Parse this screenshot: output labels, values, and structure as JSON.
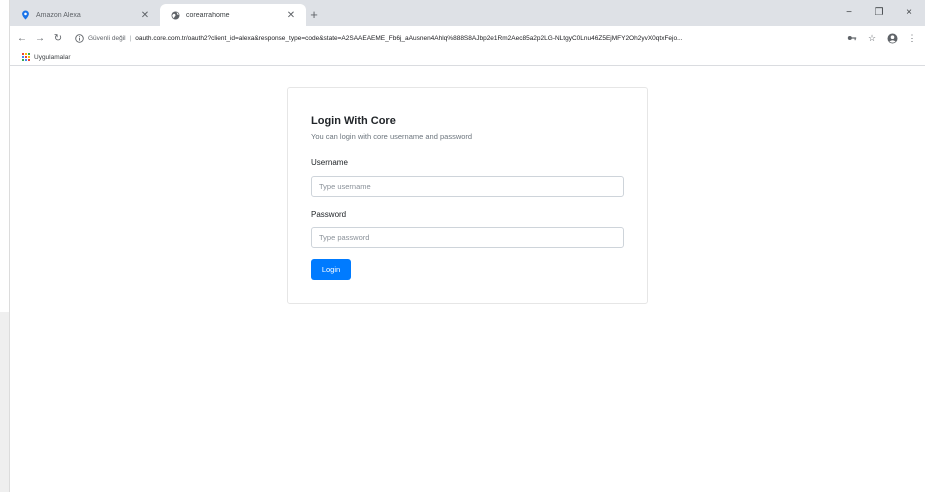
{
  "browser": {
    "tabs": [
      {
        "title": "Amazon Alexa",
        "icon": "location-pin-icon",
        "icon_color": "#1a73e8"
      },
      {
        "title": "corearrahome",
        "icon": "globe-icon"
      }
    ],
    "window_controls": {
      "minimize": "−",
      "maximize": "❐",
      "close": "×"
    },
    "address_bar": {
      "security_text": "Güvenli değil",
      "separator": "|",
      "url": "oauth.core.com.tr/oauth2?client_id=alexa&response_type=code&state=A2SAAEAEME_Fb6j_aAusnen4Ahlq%888S8AJbp2e1Rm2Aec85a2p2LG-NLtgyC0Lnu46Z5EjMFY2Oh2yvX0qtxFejo..."
    },
    "bookmarks": [
      {
        "label": "Uygulamalar",
        "icon": "apps-grid-icon"
      }
    ]
  },
  "login_card": {
    "title": "Login With Core",
    "subtitle": "You can login with core username and password",
    "username_label": "Username",
    "username_placeholder": "Type username",
    "password_label": "Password",
    "password_placeholder": "Type password",
    "button_label": "Login"
  },
  "colors": {
    "primary": "#007bff",
    "tabstrip": "#dee1e6"
  }
}
